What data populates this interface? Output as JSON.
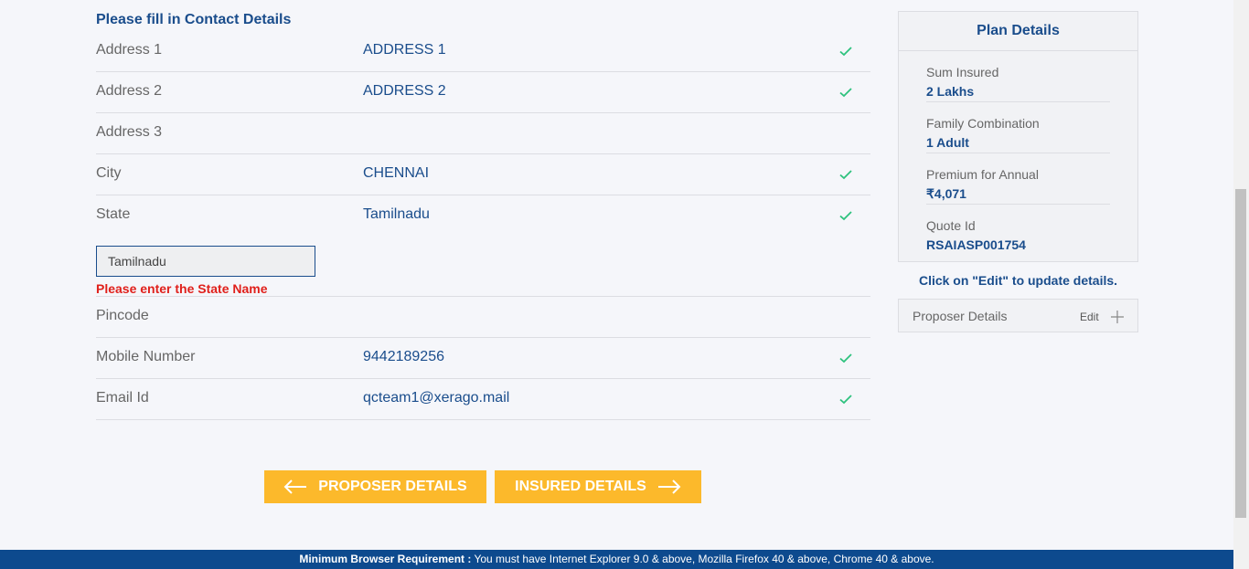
{
  "form": {
    "title": "Please fill in Contact Details",
    "rows": [
      {
        "label": "Address 1",
        "value": "ADDRESS 1",
        "valid": true
      },
      {
        "label": "Address 2",
        "value": "ADDRESS 2",
        "valid": true
      },
      {
        "label": "Address 3",
        "value": "",
        "valid": false
      },
      {
        "label": "City",
        "value": "CHENNAI",
        "valid": true
      },
      {
        "label": "State",
        "value": "Tamilnadu",
        "valid": true
      },
      {
        "label": "Pincode",
        "value": "",
        "valid": false
      },
      {
        "label": "Mobile Number",
        "value": "9442189256",
        "valid": true
      },
      {
        "label": "Email Id",
        "value": "qcteam1@xerago.mail",
        "valid": true
      }
    ],
    "state_input_value": "Tamilnadu",
    "state_error": "Please enter the State Name"
  },
  "buttons": {
    "prev_label": "PROPOSER DETAILS",
    "next_label": "INSURED DETAILS"
  },
  "plan": {
    "title": "Plan Details",
    "items": [
      {
        "key": "Sum Insured",
        "value": "2 Lakhs"
      },
      {
        "key": "Family Combination",
        "value": "1 Adult"
      },
      {
        "key": "Premium for Annual",
        "value": "₹4,071"
      },
      {
        "key": "Quote Id",
        "value": "RSAIASP001754"
      }
    ],
    "edit_note": "Click on \"Edit\" to update details."
  },
  "proposer": {
    "title": "Proposer Details",
    "edit_label": "Edit",
    "icon": "plus-icon"
  },
  "footer": {
    "bold": "Minimum Browser Requirement :",
    "text": " You must have Internet Explorer 9.0 & above, Mozilla Firefox 40 & above, Chrome 40 & above."
  },
  "colors": {
    "primary": "#1a4d8c",
    "accent": "#fcb92b",
    "error": "#e0201b",
    "check": "#2ec27e",
    "footer_bg": "#0d4a8e"
  }
}
